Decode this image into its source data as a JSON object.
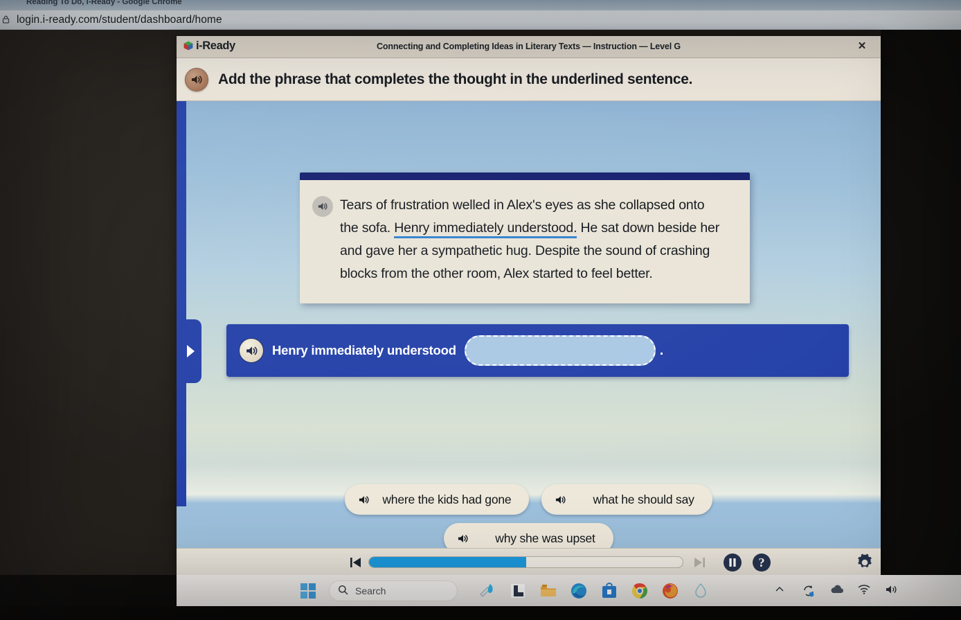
{
  "browser": {
    "tab_title": "Reading To Do, i-Ready - Google Chrome",
    "url": "login.i-ready.com/student/dashboard/home",
    "lock_icon": "site-info-icon"
  },
  "app": {
    "logo_text": "i-Ready",
    "lesson_title": "Connecting and Completing Ideas in Literary Texts — Instruction — Level G",
    "close_label": "✕",
    "directions": "Add the phrase that completes the thought in the underlined sentence.",
    "passage": {
      "part1": "Tears of frustration welled in Alex's eyes as she collapsed onto the sofa. ",
      "underlined": "Henry immediately understood.",
      "part2": " He sat down beside her and gave her a sympathetic hug. Despite the sound of crashing blocks from the other room, Alex started to feel better.",
      "underline_color": "#2f7fd0"
    },
    "answer_bar": {
      "stem": "Henry immediately understood",
      "drop_zone_value": "",
      "drop_zone_placeholder": "",
      "trailing_punctuation": ".",
      "bar_color": "#2340a8"
    },
    "choices": [
      {
        "label": "where the kids had gone"
      },
      {
        "label": "what he should say"
      },
      {
        "label": "why she was upset"
      }
    ],
    "toolbar": {
      "prev_label": "previous",
      "next_label": "next",
      "progress_percent": 50,
      "progress_fill_color": "#1d9ade",
      "pause_label": "pause",
      "help_label": "?",
      "settings_label": "settings"
    }
  },
  "taskbar": {
    "start_label": "Start",
    "search_placeholder": "Search",
    "apps": [
      "snipping-tool-icon",
      "l-app-icon",
      "file-explorer-icon",
      "microsoft-edge-icon",
      "microsoft-store-icon",
      "google-chrome-icon",
      "firefox-icon",
      "water-drop-app-icon"
    ],
    "tray": [
      "chevron-up-icon",
      "sync-icon",
      "onedrive-cloud-icon",
      "wifi-icon",
      "volume-icon"
    ]
  }
}
